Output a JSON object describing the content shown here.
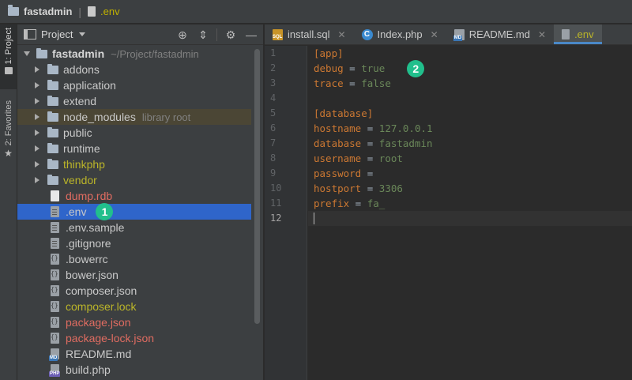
{
  "navbar": {
    "project": "fastadmin",
    "file": ".env"
  },
  "toolstrip": {
    "project_tab": "1: Project",
    "favorites_tab": "2: Favorites"
  },
  "panel": {
    "title": "Project",
    "tree": [
      {
        "label": "fastadmin",
        "hint": "~/Project/fastadmin",
        "kind": "root",
        "color": "bold"
      },
      {
        "label": "addons",
        "kind": "folder",
        "color": "normal"
      },
      {
        "label": "application",
        "kind": "folder",
        "color": "normal"
      },
      {
        "label": "extend",
        "kind": "folder",
        "color": "normal"
      },
      {
        "label": "node_modules",
        "hint": "library root",
        "kind": "folder",
        "color": "normal",
        "highlight": true
      },
      {
        "label": "public",
        "kind": "folder",
        "color": "normal"
      },
      {
        "label": "runtime",
        "kind": "folder",
        "color": "normal"
      },
      {
        "label": "thinkphp",
        "kind": "folder",
        "color": "yellow"
      },
      {
        "label": "vendor",
        "kind": "folder",
        "color": "yellow"
      },
      {
        "label": "dump.rdb",
        "kind": "file-white",
        "color": "red"
      },
      {
        "label": ".env",
        "kind": "file-text",
        "color": "normal",
        "selected": true,
        "callout": "1"
      },
      {
        "label": ".env.sample",
        "kind": "file-text",
        "color": "normal"
      },
      {
        "label": ".gitignore",
        "kind": "file-text",
        "color": "normal"
      },
      {
        "label": ".bowerrc",
        "kind": "file-braces",
        "color": "normal"
      },
      {
        "label": "bower.json",
        "kind": "file-braces",
        "color": "normal"
      },
      {
        "label": "composer.json",
        "kind": "file-braces",
        "color": "normal"
      },
      {
        "label": "composer.lock",
        "kind": "file-braces",
        "color": "yellow"
      },
      {
        "label": "package.json",
        "kind": "file-braces",
        "color": "red"
      },
      {
        "label": "package-lock.json",
        "kind": "file-braces",
        "color": "red"
      },
      {
        "label": "README.md",
        "kind": "file-md",
        "color": "normal",
        "badge": "MD"
      },
      {
        "label": "build.php",
        "kind": "file-php",
        "color": "normal",
        "badge": "PHP"
      }
    ]
  },
  "tabs": [
    {
      "label": "install.sql",
      "icon": "sql-file-icon",
      "badge": "SQL"
    },
    {
      "label": "Index.php",
      "icon": "php-class-icon",
      "badge": "C"
    },
    {
      "label": "README.md",
      "icon": "markdown-file-icon",
      "badge": "MD"
    },
    {
      "label": ".env",
      "icon": "env-file-icon",
      "active": true
    }
  ],
  "editor": {
    "callout": "2",
    "lines": [
      {
        "n": "1",
        "section": "[app]"
      },
      {
        "n": "2",
        "key": "debug",
        "value": "true"
      },
      {
        "n": "3",
        "key": "trace",
        "value": "false"
      },
      {
        "n": "4"
      },
      {
        "n": "5",
        "section": "[database]"
      },
      {
        "n": "6",
        "key": "hostname",
        "value": "127.0.0.1"
      },
      {
        "n": "7",
        "key": "database",
        "value": "fastadmin"
      },
      {
        "n": "8",
        "key": "username",
        "value": "root"
      },
      {
        "n": "9",
        "key": "password",
        "value": ""
      },
      {
        "n": "10",
        "key": "hostport",
        "value": "3306"
      },
      {
        "n": "11",
        "key": "prefix",
        "value": "fa_"
      },
      {
        "n": "12"
      }
    ]
  }
}
